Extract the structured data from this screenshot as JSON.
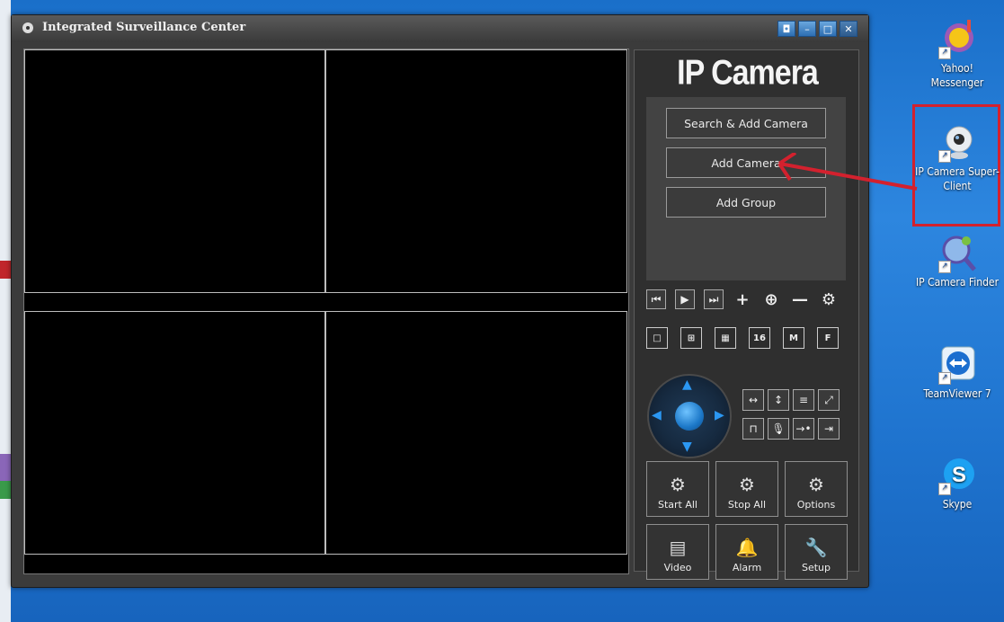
{
  "window": {
    "title": "Integrated Surveillance Center",
    "controls": [
      "◘",
      "–",
      "□",
      "✕"
    ]
  },
  "panel": {
    "brand": "IP Camera",
    "buttons": {
      "search_add": "Search & Add Camera",
      "add_camera": "Add Camera",
      "add_group": "Add Group"
    },
    "playback": [
      "⏮",
      "▶",
      "⏭",
      "+",
      "⊕",
      "—",
      "⚙"
    ],
    "layouts": [
      "□",
      "⊞",
      "▦",
      "16",
      "M",
      "F"
    ],
    "ptz_tools": [
      "↔",
      "↕",
      "≡",
      "⤢",
      "⊓",
      "🎙",
      "→•",
      "⇥"
    ],
    "actions": [
      {
        "label": "Start All",
        "icon": "⚙"
      },
      {
        "label": "Stop All",
        "icon": "⚙"
      },
      {
        "label": "Options",
        "icon": "⚙"
      },
      {
        "label": "Video",
        "icon": "▤"
      },
      {
        "label": "Alarm",
        "icon": "🔔"
      },
      {
        "label": "Setup",
        "icon": "🔧"
      }
    ]
  },
  "desktop_icons": [
    {
      "label": "Yahoo! Messenger"
    },
    {
      "label": "IP Camera Super-Client"
    },
    {
      "label": "IP Camera Finder"
    },
    {
      "label": "TeamViewer 7"
    },
    {
      "label": "Skype"
    }
  ],
  "colors": {
    "desktop": "#1f74cf",
    "highlight": "#d3212e",
    "ptz_accent": "#2b97f2"
  }
}
